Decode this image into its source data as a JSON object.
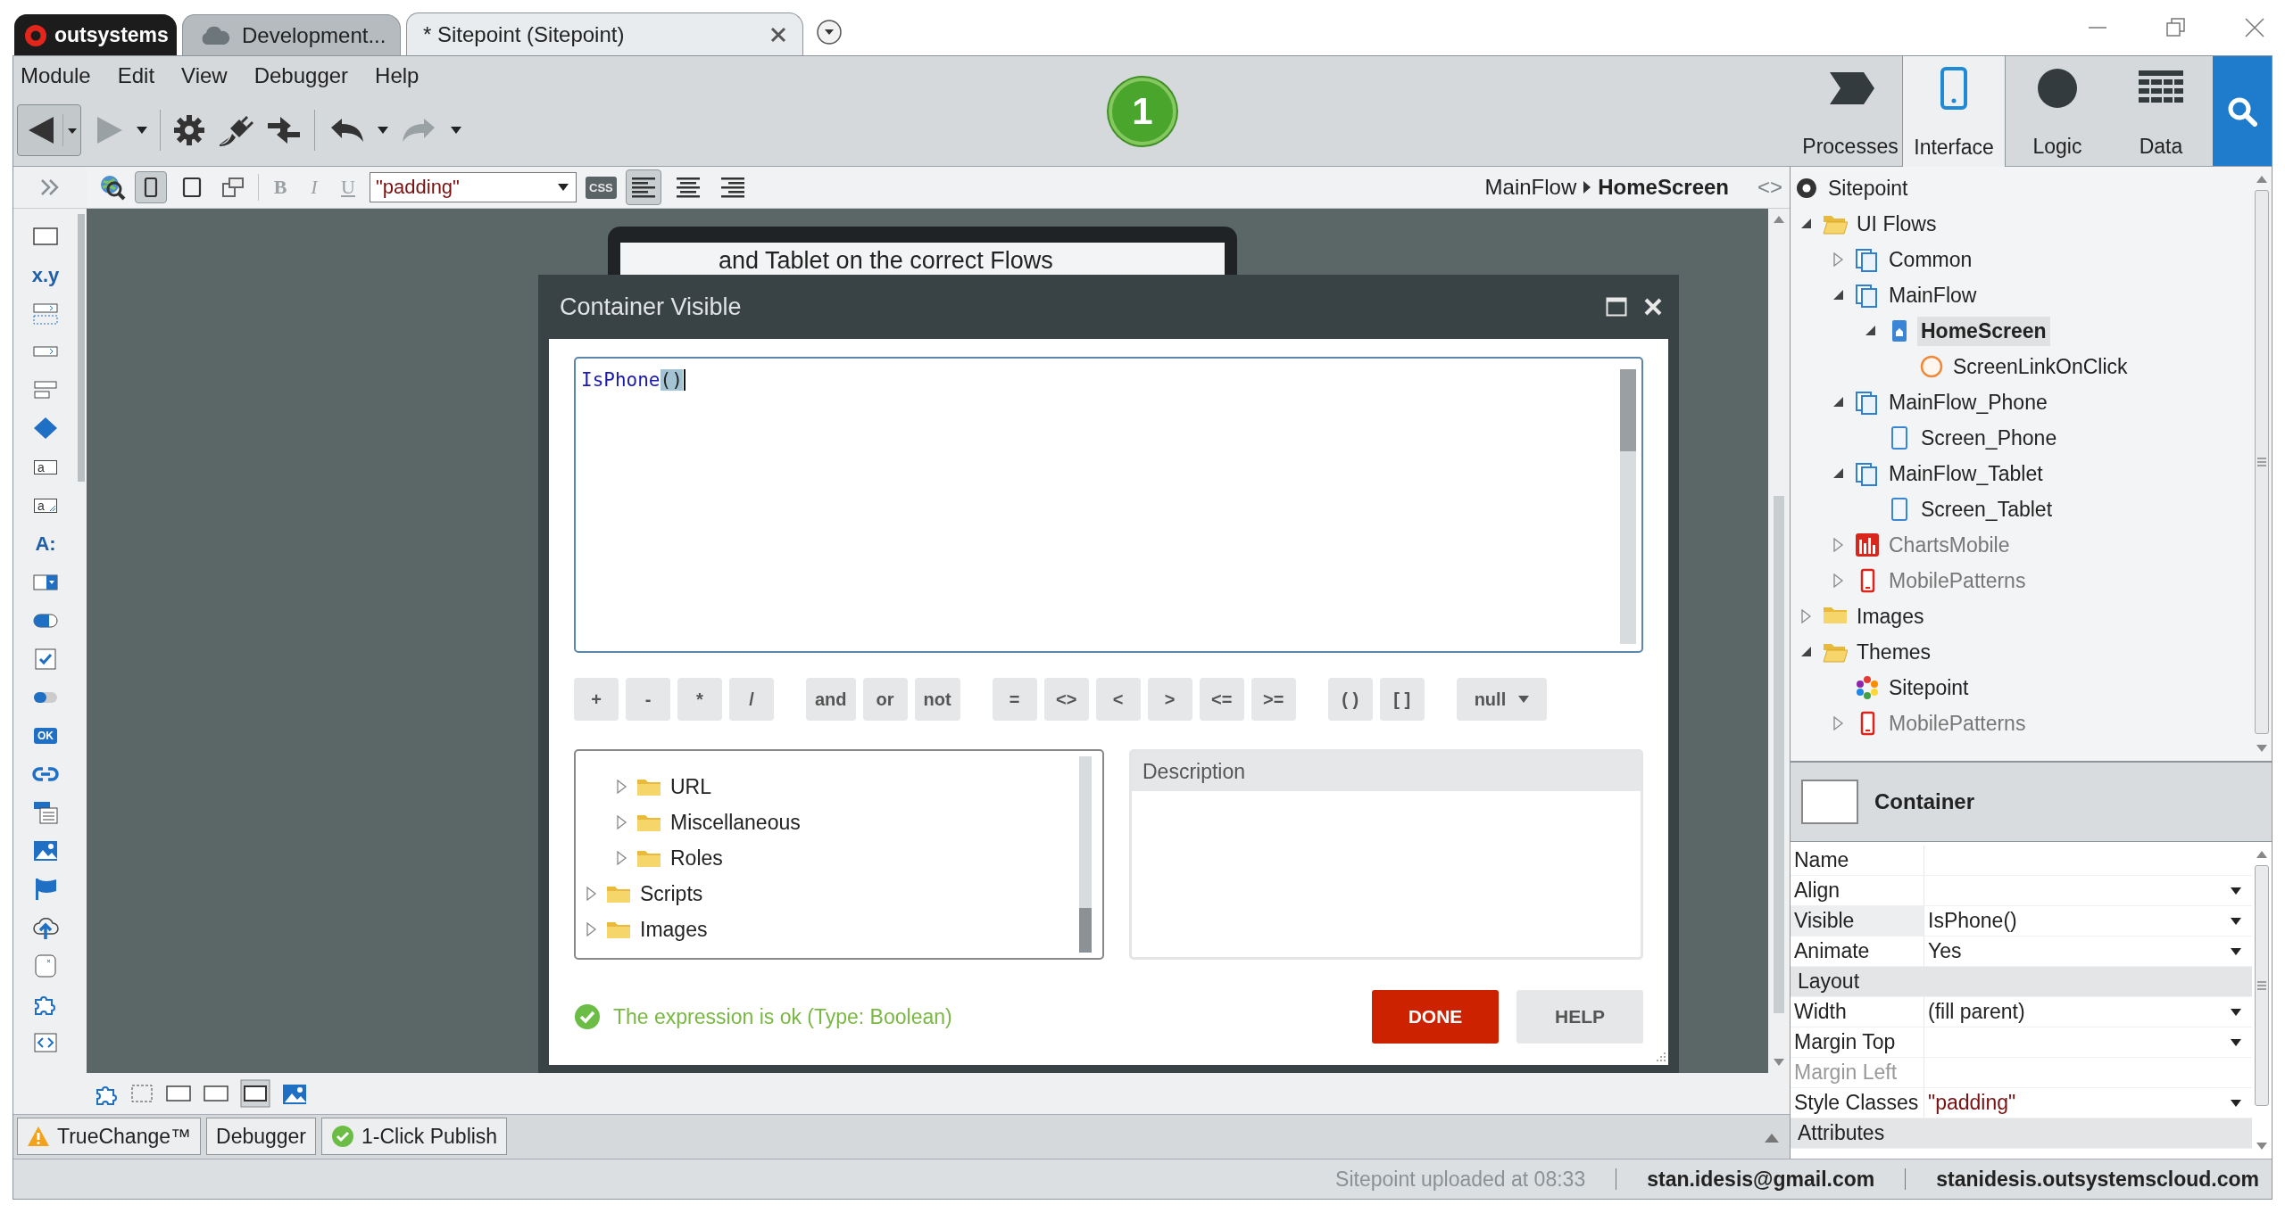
{
  "app_tabs": [
    {
      "kind": "logo",
      "label": "outsystems",
      "selected": false
    },
    {
      "kind": "environment",
      "label": "Development...",
      "selected": false
    },
    {
      "kind": "module",
      "label": "* Sitepoint (Sitepoint)",
      "selected": true
    }
  ],
  "menu": [
    "Module",
    "Edit",
    "View",
    "Debugger",
    "Help"
  ],
  "publish_badge": "1",
  "layer_tabs": [
    {
      "kind": "processes",
      "label": "Processes",
      "selected": false
    },
    {
      "kind": "interface",
      "label": "Interface",
      "selected": true
    },
    {
      "kind": "logic",
      "label": "Logic",
      "selected": false
    },
    {
      "kind": "data",
      "label": "Data",
      "selected": false
    }
  ],
  "editor_toolbar": {
    "device_buttons": [
      {
        "kind": "phone",
        "selected": true
      },
      {
        "kind": "tablet",
        "selected": false
      },
      {
        "kind": "rotate",
        "selected": false
      }
    ],
    "format_buttons": [
      "B",
      "I",
      "U"
    ],
    "style_classes": "\"padding\"",
    "css_button": "CSS",
    "align_buttons": [
      {
        "kind": "left",
        "selected": true
      },
      {
        "kind": "center",
        "selected": false
      },
      {
        "kind": "right",
        "selected": false
      }
    ],
    "breadcrumb": [
      "MainFlow",
      "HomeScreen"
    ],
    "code_toggle": "<>"
  },
  "palette": [
    {
      "kind": "container"
    },
    {
      "kind": "expression",
      "glyph": "x.y"
    },
    {
      "kind": "list"
    },
    {
      "kind": "link-box"
    },
    {
      "kind": "columns"
    },
    {
      "kind": "if"
    },
    {
      "kind": "input",
      "glyph": "a"
    },
    {
      "kind": "textarea",
      "glyph": "a"
    },
    {
      "kind": "label",
      "glyph": "A:"
    },
    {
      "kind": "dropdown"
    },
    {
      "kind": "switch"
    },
    {
      "kind": "checkbox"
    },
    {
      "kind": "toggle"
    },
    {
      "kind": "button",
      "glyph": "OK"
    },
    {
      "kind": "link"
    },
    {
      "kind": "popover"
    },
    {
      "kind": "image"
    },
    {
      "kind": "flag"
    },
    {
      "kind": "upload"
    },
    {
      "kind": "popup"
    },
    {
      "kind": "block"
    },
    {
      "kind": "html"
    }
  ],
  "canvas": {
    "banner_text": "and Tablet on the correct Flows"
  },
  "dialog": {
    "title": "Container Visible",
    "expression": {
      "text": "IsPhone",
      "selected_text": "()"
    },
    "operator_groups": [
      [
        "+",
        "-",
        "*",
        "/"
      ],
      [
        "and",
        "or",
        "not"
      ],
      [
        "=",
        "<>",
        "<",
        ">",
        "<=",
        ">="
      ],
      [
        "( )",
        "[ ]"
      ]
    ],
    "null_dropdown": "null",
    "tree": [
      {
        "children": [
          {
            "kind": "folder",
            "label": "URL",
            "expanded": false
          },
          {
            "kind": "folder",
            "label": "Miscellaneous",
            "expanded": false
          },
          {
            "kind": "folder",
            "label": "Roles",
            "expanded": false
          }
        ]
      },
      {
        "kind": "folder",
        "label": "Scripts",
        "expanded": false
      },
      {
        "kind": "folder",
        "label": "Images",
        "expanded": false
      }
    ],
    "description_title": "Description",
    "status": {
      "ok": true,
      "text": "The expression is ok (Type: Boolean)"
    },
    "buttons": [
      {
        "label": "DONE",
        "primary": true
      },
      {
        "label": "HELP",
        "primary": false
      }
    ]
  },
  "bottom_tabs": [
    {
      "kind": "warning",
      "label": "TrueChange™"
    },
    {
      "kind": "plain",
      "label": "Debugger"
    },
    {
      "kind": "ok",
      "label": "1-Click Publish"
    }
  ],
  "explorer": [
    {
      "kind": "module",
      "label": "Sitepoint",
      "selected": false,
      "reference": false,
      "children": [
        {
          "kind": "folder-open",
          "label": "UI Flows",
          "expanded": true,
          "selected": false,
          "reference": false,
          "children": [
            {
              "kind": "flow",
              "label": "Common",
              "expanded": false,
              "selected": false,
              "reference": false
            },
            {
              "kind": "flow",
              "label": "MainFlow",
              "expanded": true,
              "selected": false,
              "reference": false,
              "children": [
                {
                  "kind": "home-screen",
                  "label": "HomeScreen",
                  "expanded": true,
                  "selected": true,
                  "reference": false,
                  "children": [
                    {
                      "kind": "action",
                      "label": "ScreenLinkOnClick",
                      "selected": false,
                      "reference": false
                    }
                  ]
                }
              ]
            },
            {
              "kind": "flow",
              "label": "MainFlow_Phone",
              "expanded": true,
              "selected": false,
              "reference": false,
              "children": [
                {
                  "kind": "screen",
                  "label": "Screen_Phone",
                  "selected": false,
                  "reference": false
                }
              ]
            },
            {
              "kind": "flow",
              "label": "MainFlow_Tablet",
              "expanded": true,
              "selected": false,
              "reference": false,
              "children": [
                {
                  "kind": "screen",
                  "label": "Screen_Tablet",
                  "selected": false,
                  "reference": false
                }
              ]
            },
            {
              "kind": "chart",
              "label": "ChartsMobile",
              "expanded": false,
              "selected": false,
              "reference": true
            },
            {
              "kind": "mobile",
              "label": "MobilePatterns",
              "expanded": false,
              "selected": false,
              "reference": true
            }
          ]
        },
        {
          "kind": "folder",
          "label": "Images",
          "expanded": false,
          "selected": false,
          "reference": false
        },
        {
          "kind": "folder-open",
          "label": "Themes",
          "expanded": true,
          "selected": false,
          "reference": false,
          "children": [
            {
              "kind": "theme",
              "label": "Sitepoint",
              "selected": false,
              "reference": false
            },
            {
              "kind": "mobile",
              "label": "MobilePatterns",
              "expanded": false,
              "selected": false,
              "reference": true
            }
          ]
        }
      ]
    }
  ],
  "properties": {
    "title": "Container",
    "rows": [
      {
        "kind": "property",
        "name": "Name",
        "dropdown": false,
        "disabled": false,
        "selected": false
      },
      {
        "kind": "property",
        "name": "Align",
        "dropdown": true,
        "disabled": false,
        "selected": false
      },
      {
        "kind": "property",
        "name": "Visible",
        "value": "IsPhone()",
        "dropdown": true,
        "disabled": false,
        "selected": true,
        "literal": false
      },
      {
        "kind": "property",
        "name": "Animate",
        "value": "Yes",
        "dropdown": true,
        "disabled": false,
        "selected": false,
        "literal": false
      },
      {
        "kind": "section",
        "name": "Layout"
      },
      {
        "kind": "property",
        "name": "Width",
        "value": "(fill parent)",
        "dropdown": true,
        "disabled": false,
        "selected": false,
        "literal": false
      },
      {
        "kind": "property",
        "name": "Margin Top",
        "dropdown": true,
        "disabled": false,
        "selected": false
      },
      {
        "kind": "property",
        "name": "Margin Left",
        "dropdown": false,
        "disabled": true,
        "selected": false
      },
      {
        "kind": "property",
        "name": "Style Classes",
        "value": "\"padding\"",
        "dropdown": true,
        "disabled": false,
        "selected": false,
        "literal": true
      },
      {
        "kind": "section",
        "name": "Attributes"
      }
    ]
  },
  "status_bar": [
    {
      "text": "Sitepoint uploaded at 08:33",
      "bold": false
    },
    {
      "text": "stan.idesis@gmail.com",
      "bold": true
    },
    {
      "text": "stanidesis.outsystemscloud.com",
      "bold": true
    }
  ]
}
